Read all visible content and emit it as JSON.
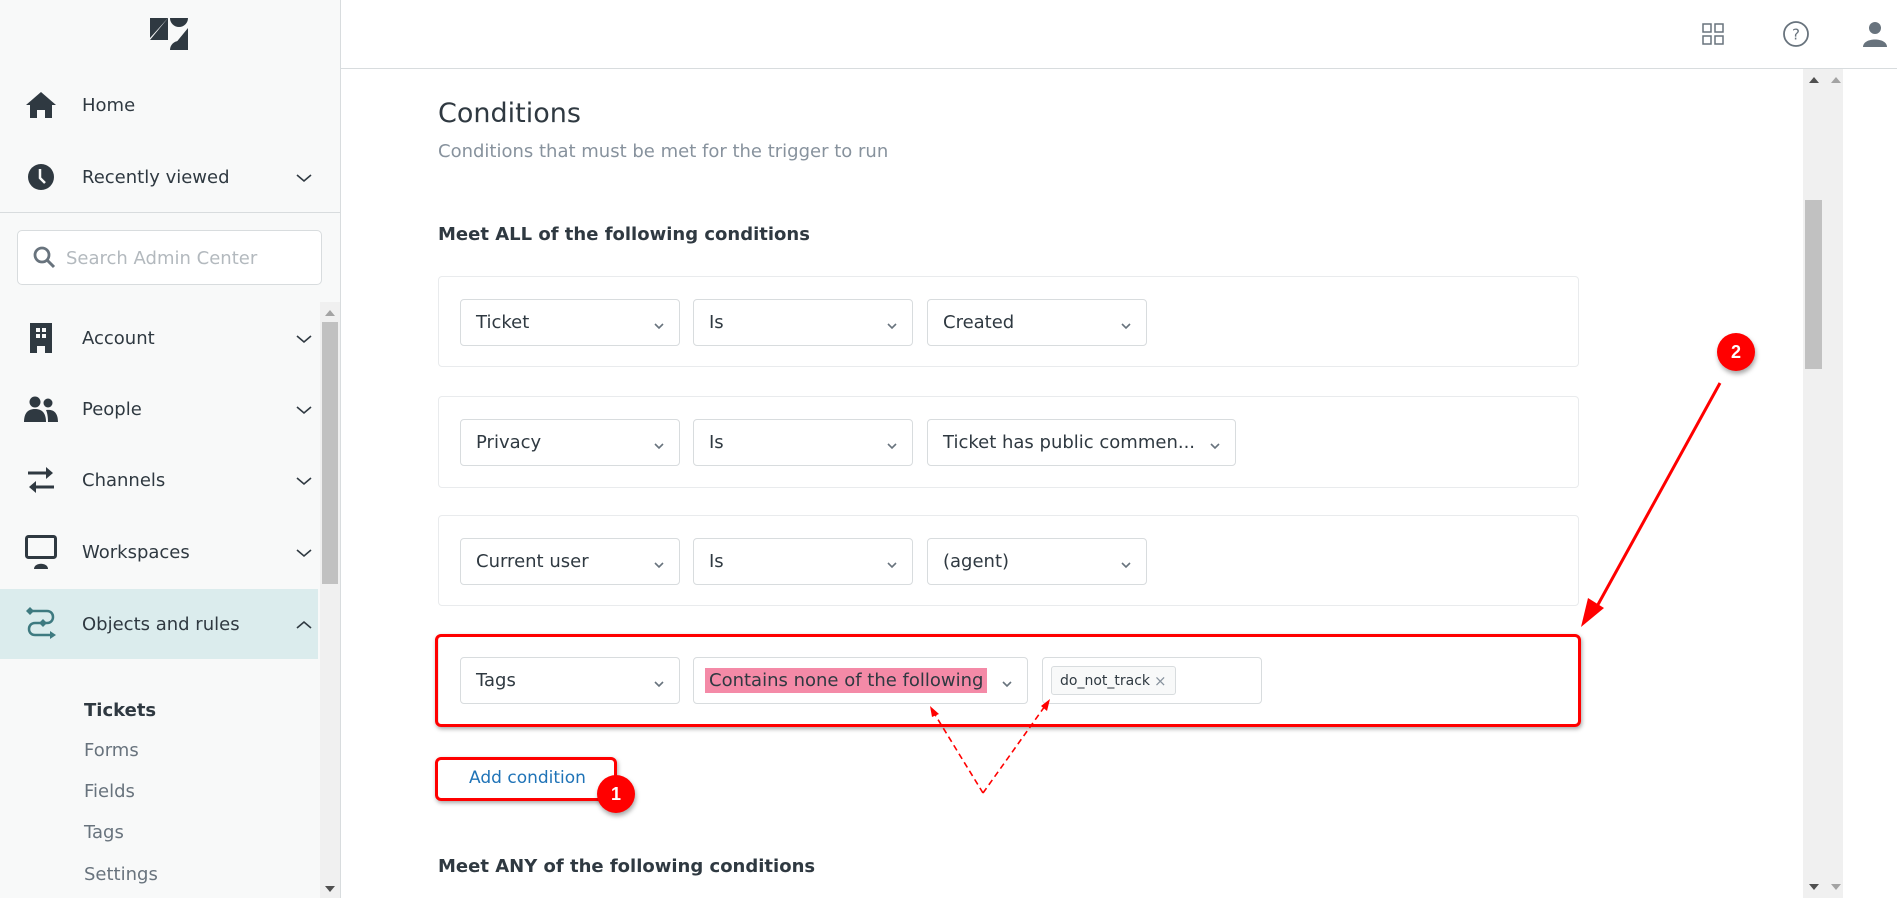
{
  "sidebar": {
    "logo": "zendesk-logo",
    "top_items": [
      {
        "label": "Home",
        "icon": "home-icon"
      },
      {
        "label": "Recently viewed",
        "icon": "clock-icon",
        "expandable": true
      }
    ],
    "search": {
      "placeholder": "Search Admin Center",
      "value": ""
    },
    "items": [
      {
        "label": "Account",
        "icon": "building-icon",
        "expanded": false
      },
      {
        "label": "People",
        "icon": "people-icon",
        "expanded": false
      },
      {
        "label": "Channels",
        "icon": "arrows-swap-icon",
        "expanded": false
      },
      {
        "label": "Workspaces",
        "icon": "monitor-icon",
        "expanded": false
      },
      {
        "label": "Objects and rules",
        "icon": "objects-rules-icon",
        "expanded": true,
        "active": true
      }
    ],
    "sub_items": [
      {
        "label": "Tickets",
        "current": true
      },
      {
        "label": "Forms"
      },
      {
        "label": "Fields"
      },
      {
        "label": "Tags"
      },
      {
        "label": "Settings"
      }
    ]
  },
  "topbar": {
    "icons": [
      "products-grid-icon",
      "help-icon",
      "user-profile-icon"
    ]
  },
  "main": {
    "title": "Conditions",
    "subtitle": "Conditions that must be met for the trigger to run",
    "all_heading": "Meet ALL of the following conditions",
    "any_heading": "Meet ANY of the following conditions",
    "conditions": [
      {
        "field": "Ticket",
        "operator": "Is",
        "value": "Created"
      },
      {
        "field": "Privacy",
        "operator": "Is",
        "value": "Ticket has public commen..."
      },
      {
        "field": "Current user",
        "operator": "Is",
        "value": "(agent)"
      },
      {
        "field": "Tags",
        "operator": "Contains none of the following",
        "tags": [
          "do_not_track"
        ],
        "tag_remove": "×"
      }
    ],
    "add_condition_label": "Add condition"
  },
  "annotations": {
    "badge_1": "1",
    "badge_2": "2",
    "highlight_color": "#f48aa7",
    "annotation_color": "#ff0000"
  }
}
